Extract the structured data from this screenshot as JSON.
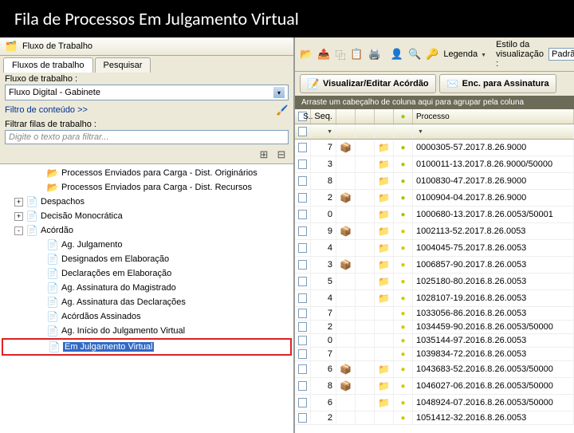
{
  "title": "Fila de Processos Em Julgamento Virtual",
  "left": {
    "header": "Fluxo de Trabalho",
    "tabs": [
      "Fluxos de trabalho",
      "Pesquisar"
    ],
    "fluxo_label": "Fluxo de trabalho :",
    "fluxo_value": "Fluxo Digital - Gabinete",
    "filtro_link": "Filtro de conteúdo >>",
    "filtrar_label": "Filtrar filas de trabalho :",
    "filtrar_placeholder": "Digite o texto para filtrar...",
    "tree": {
      "items": [
        {
          "level": 2,
          "icon": "folder-open",
          "label": "Processos Enviados para Carga - Dist. Originários"
        },
        {
          "level": 2,
          "icon": "folder-open",
          "label": "Processos Enviados para Carga - Dist. Recursos"
        },
        {
          "level": 1,
          "toggle": "+",
          "icon": "doc",
          "label": "Despachos"
        },
        {
          "level": 1,
          "toggle": "+",
          "icon": "doc",
          "label": "Decisão Monocrática"
        },
        {
          "level": 1,
          "toggle": "-",
          "icon": "doc",
          "label": "Acórdão"
        },
        {
          "level": 2,
          "icon": "doc",
          "label": "Ag. Julgamento"
        },
        {
          "level": 2,
          "icon": "doc",
          "label": "Designados em Elaboração"
        },
        {
          "level": 2,
          "icon": "doc",
          "label": "Declarações em Elaboração"
        },
        {
          "level": 2,
          "icon": "doc",
          "label": "Ag. Assinatura do Magistrado"
        },
        {
          "level": 2,
          "icon": "doc",
          "label": "Ag. Assinatura das Declarações"
        },
        {
          "level": 2,
          "icon": "doc",
          "label": "Acórdãos Assinados"
        },
        {
          "level": 2,
          "icon": "doc",
          "label": "Ag. Início do Julgamento Virtual"
        },
        {
          "level": 2,
          "icon": "doc",
          "label": "Em Julgamento Virtual",
          "selected": true
        }
      ]
    }
  },
  "right": {
    "toolbar": {
      "legenda": "Legenda",
      "estilo_label": "Estilo da visualização :",
      "estilo_value": "Padrão"
    },
    "buttons": {
      "visualizar": "Visualizar/Editar Acórdão",
      "enc": "Enc. para Assinatura"
    },
    "group_hint": "Arraste um cabeçalho de coluna aqui para agrupar pela coluna",
    "columns": {
      "seq": "Seq.",
      "processo": "Processo"
    },
    "rows": [
      {
        "seq": "7",
        "i1": "box",
        "i3": "folder",
        "flag": "g",
        "proc": "0000305-57.2017.8.26.9000"
      },
      {
        "seq": "3",
        "i3": "folder",
        "flag": "g",
        "proc": "0100011-13.2017.8.26.9000/50000"
      },
      {
        "seq": "8",
        "i3": "folder",
        "flag": "g",
        "proc": "0100830-47.2017.8.26.9000"
      },
      {
        "seq": "2",
        "i1": "box",
        "i3": "folder",
        "flag": "g",
        "proc": "0100904-04.2017.8.26.9000"
      },
      {
        "seq": "0",
        "i3": "folder",
        "flag": "g",
        "proc": "1000680-13.2017.8.26.0053/50001"
      },
      {
        "seq": "9",
        "i1": "box",
        "i3": "folder",
        "flag": "y",
        "proc": "1002113-52.2017.8.26.0053"
      },
      {
        "seq": "4",
        "i3": "folder",
        "flag": "y",
        "proc": "1004045-75.2017.8.26.0053"
      },
      {
        "seq": "3",
        "i1": "box",
        "i3": "folder",
        "flag": "y",
        "proc": "1006857-90.2017.8.26.0053"
      },
      {
        "seq": "5",
        "i3": "folder",
        "flag": "y",
        "proc": "1025180-80.2016.8.26.0053"
      },
      {
        "seq": "4",
        "i3": "folder",
        "flag": "y",
        "proc": "1028107-19.2016.8.26.0053"
      },
      {
        "seq": "7",
        "flag": "y",
        "proc": "1033056-86.2016.8.26.0053"
      },
      {
        "seq": "2",
        "flag": "y",
        "proc": "1034459-90.2016.8.26.0053/50000"
      },
      {
        "seq": "0",
        "flag": "y",
        "proc": "1035144-97.2016.8.26.0053"
      },
      {
        "seq": "7",
        "flag": "y",
        "proc": "1039834-72.2016.8.26.0053"
      },
      {
        "seq": "6",
        "i1": "box",
        "i3": "folder",
        "flag": "y",
        "proc": "1043683-52.2016.8.26.0053/50000"
      },
      {
        "seq": "8",
        "i1": "box",
        "i3": "folder",
        "flag": "y",
        "proc": "1046027-06.2016.8.26.0053/50000"
      },
      {
        "seq": "6",
        "i3": "folder",
        "flag": "y",
        "proc": "1048924-07.2016.8.26.0053/50000"
      },
      {
        "seq": "2",
        "flag": "y",
        "proc": "1051412-32.2016.8.26.0053"
      }
    ]
  }
}
